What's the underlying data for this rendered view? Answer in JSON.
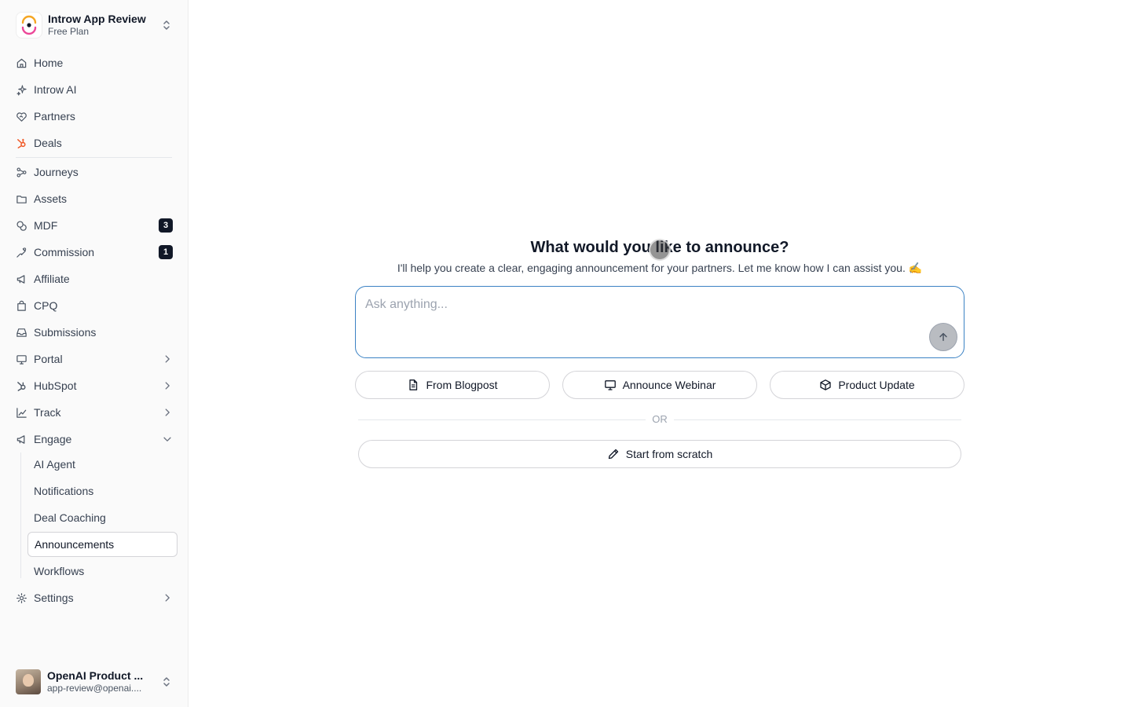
{
  "workspace": {
    "name": "Introw App Review",
    "plan": "Free Plan"
  },
  "nav": [
    {
      "label": "Home",
      "icon": "home-icon"
    },
    {
      "label": "Introw AI",
      "icon": "sparkle-icon"
    },
    {
      "label": "Partners",
      "icon": "handshake-heart-icon"
    },
    {
      "label": "Deals",
      "icon": "hubspot-icon"
    },
    {
      "label": "Journeys",
      "icon": "journey-icon"
    },
    {
      "label": "Assets",
      "icon": "folder-icon"
    },
    {
      "label": "MDF",
      "icon": "coins-icon",
      "badge": "3"
    },
    {
      "label": "Commission",
      "icon": "hand-coins-icon",
      "badge": "1"
    },
    {
      "label": "Affiliate",
      "icon": "megaphone-icon"
    },
    {
      "label": "CPQ",
      "icon": "bag-icon"
    },
    {
      "label": "Submissions",
      "icon": "inbox-icon"
    },
    {
      "label": "Portal",
      "icon": "monitor-icon"
    },
    {
      "label": "HubSpot",
      "icon": "hubspot-icon"
    },
    {
      "label": "Track",
      "icon": "chart-line-icon"
    },
    {
      "label": "Engage",
      "icon": "megaphone-icon"
    },
    {
      "label": "Settings",
      "icon": "gear-icon"
    }
  ],
  "engage_sub": [
    "AI Agent",
    "Notifications",
    "Deal Coaching",
    "Announcements",
    "Workflows"
  ],
  "active_sub": "Announcements",
  "user": {
    "name": "OpenAI Product ...",
    "email": "app-review@openai...."
  },
  "main": {
    "heading": "What would you like to announce?",
    "subheading": "I'll help you create a clear, engaging announcement for your partners. Let me know how I can assist you. ✍️",
    "input_placeholder": "Ask anything...",
    "chips": [
      "From Blogpost",
      "Announce Webinar",
      "Product Update"
    ],
    "or_label": "OR",
    "scratch_label": "Start from scratch"
  },
  "colors": {
    "accent_border": "#3b82c4",
    "hubspot": "#f05a28",
    "badge_bg": "#111827"
  }
}
